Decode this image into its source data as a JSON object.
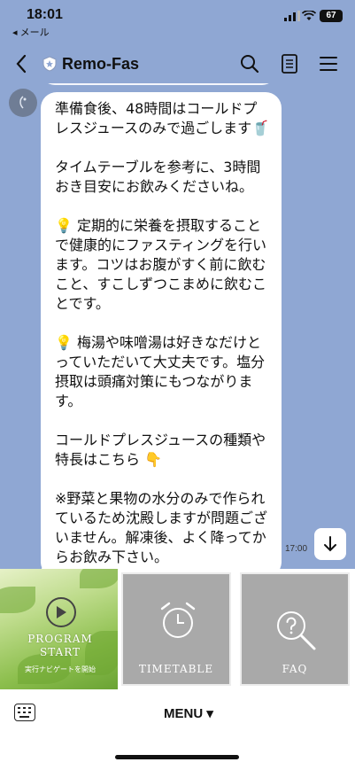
{
  "status_bar": {
    "time": "18:01",
    "back_app": "◂ メール",
    "battery": "67"
  },
  "header": {
    "title": "Remo-Fas"
  },
  "message": {
    "paragraphs": [
      "準備食後、48時間はコールドプレスジュースのみで過ごします🥤",
      "タイムテーブルを参考に、3時間おき目安にお飲みくださいね。",
      "💡 定期的に栄養を摂取することで健康的にファスティングを行います。コツはお腹がすく前に飲むこと、すこしずつこまめに飲むことです。",
      "💡 梅湯や味噌湯は好きなだけとっていただいて大丈夫です。塩分摂取は頭痛対策にもつながります。",
      "コールドプレスジュースの種類や特長はこちら 👇",
      "※野菜と果物の水分のみで作られているため沈殿しますが問題ございません。解凍後、よく降ってからお飲み下さい。"
    ],
    "time": "17:00"
  },
  "rich_menu": {
    "start": {
      "title_line1": "PROGRAM",
      "title_line2": "START",
      "subtitle": "実行ナビゲートを開始"
    },
    "timetable": {
      "label": "TIMETABLE"
    },
    "faq": {
      "label": "FAQ"
    }
  },
  "bottom_bar": {
    "menu_label": "MENU ▾"
  },
  "colors": {
    "chat_bg": "#8fa7d3",
    "tile_gray": "#a9a9a9",
    "green": "#8dbf4e"
  }
}
